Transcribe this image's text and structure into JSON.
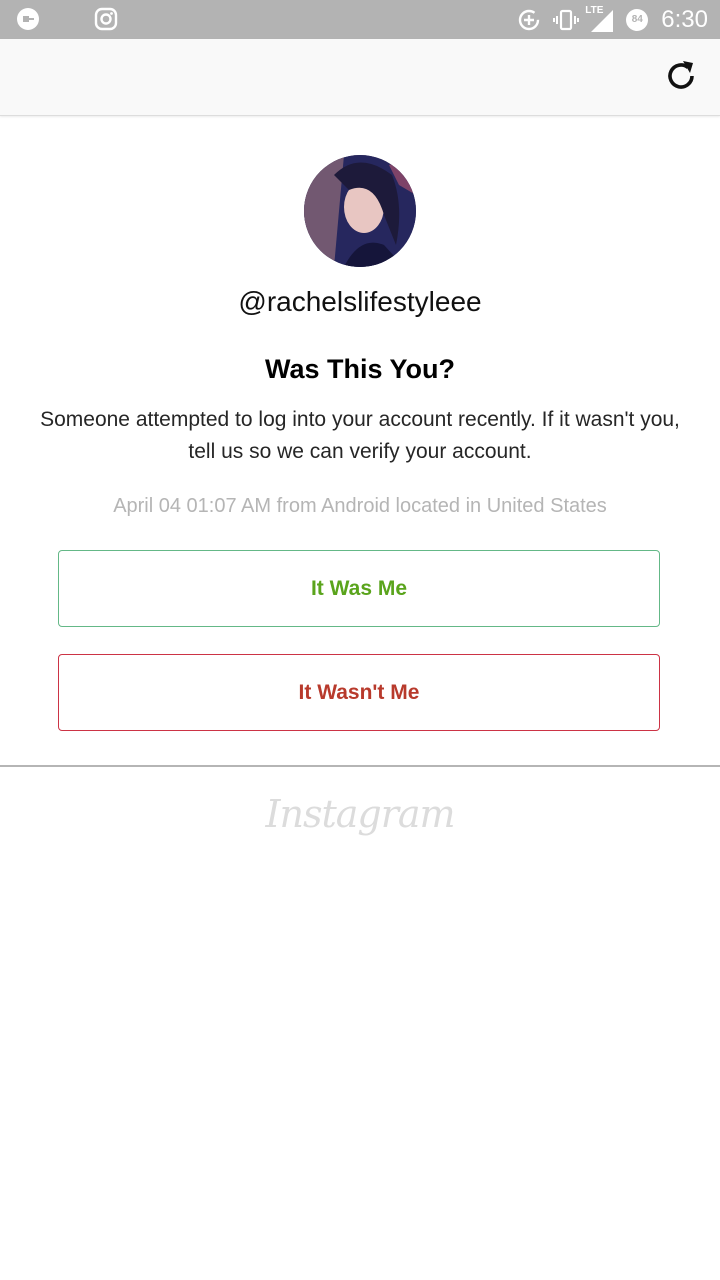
{
  "status_bar": {
    "time": "6:30",
    "network": "LTE",
    "battery": "84",
    "icons": [
      "uber-icon",
      "instagram-icon",
      "data-saver-icon",
      "vibrate-icon",
      "signal-icon",
      "battery-icon"
    ]
  },
  "toolbar": {
    "refresh_icon": "refresh-icon"
  },
  "profile": {
    "username": "@rachelslifestyleee"
  },
  "prompt": {
    "title": "Was This You?",
    "description": "Someone attempted to log into your account recently. If it wasn't you, tell us so we can verify your account.",
    "meta": "April 04 01:07 AM from Android located in United States"
  },
  "actions": {
    "confirm_label": "It Was Me",
    "deny_label": "It Wasn't Me"
  },
  "footer": {
    "logo_text": "Instagram"
  },
  "colors": {
    "confirm": "#5aa41c",
    "deny": "#b83a2c",
    "status_bar": "#b3b3b3"
  }
}
